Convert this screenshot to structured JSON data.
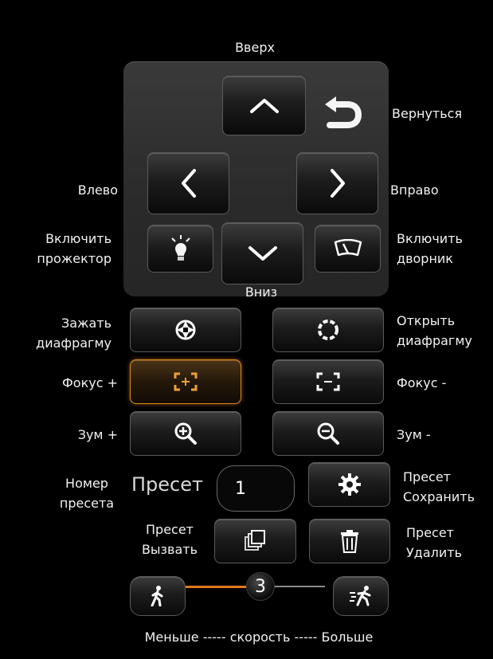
{
  "ptz": {
    "up_label": "Вверх",
    "down_label": "Вниз",
    "left_label": "Влево",
    "right_label": "Вправо",
    "return_label": "Вернуться",
    "light_label_1": "Включить",
    "light_label_2": "прожектор",
    "wiper_label_1": "Включить",
    "wiper_label_2": "дворник"
  },
  "iris": {
    "close_label_1": "Зажать",
    "close_label_2": "диафрагму",
    "open_label_1": "Открыть",
    "open_label_2": "диафрагму"
  },
  "focus": {
    "plus_label": "Фокус +",
    "minus_label": "Фокус -"
  },
  "zoom": {
    "plus_label": "Зум +",
    "minus_label": "Зум -"
  },
  "preset": {
    "number_label_1": "Номер",
    "number_label_2": "пресета",
    "field_prefix": "Пресет",
    "value": "1",
    "save_label_1": "Пресет",
    "save_label_2": "Сохранить",
    "call_label_1": "Пресет",
    "call_label_2": "Вызвать",
    "delete_label_1": "Пресет",
    "delete_label_2": "Удалить"
  },
  "speed": {
    "value": "3",
    "caption": "Меньше ----- скорость ----- Больше"
  },
  "colors": {
    "accent": "#e07a1a",
    "active_border": "#d98a1c"
  }
}
